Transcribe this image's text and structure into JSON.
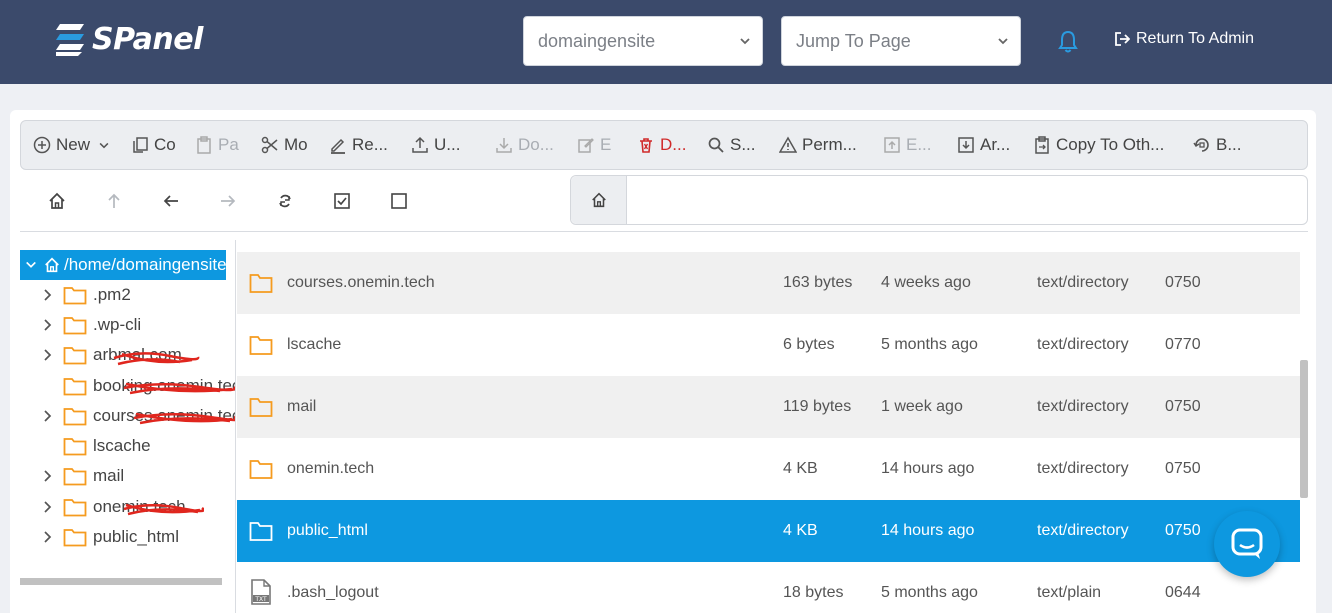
{
  "header": {
    "brand": "SPanel",
    "account_select": "domaingensite",
    "jump_to_page": "Jump To Page",
    "return_to_admin": "Return To Admin",
    "colors": {
      "header_bg": "#3b4a6b",
      "accent": "#0d98e0"
    }
  },
  "toolbar": {
    "new": "New",
    "copy": "Co",
    "paste": "Pa",
    "move": "Mo",
    "rename": "Re...",
    "upload": "U...",
    "download": "Do...",
    "edit": "E",
    "delete": "D...",
    "search": "S...",
    "permissions": "Perm...",
    "extract": "E...",
    "archive": "Ar...",
    "copy_to_other": "Copy To Oth...",
    "backup": "B..."
  },
  "tree": {
    "root": "/home/domaingensite",
    "items": [
      {
        "label": ".pm2",
        "expandable": true
      },
      {
        "label": ".wp-cli",
        "expandable": true
      },
      {
        "label": "arbmal.com",
        "expandable": true,
        "redacted": true
      },
      {
        "label": "booking.onemin.tech",
        "expandable": false,
        "redacted": true
      },
      {
        "label": "courses.onemin.tech",
        "expandable": true,
        "redacted": true
      },
      {
        "label": "lscache",
        "expandable": false
      },
      {
        "label": "mail",
        "expandable": true
      },
      {
        "label": "onemin.tech",
        "expandable": true,
        "redacted": true
      },
      {
        "label": "public_html",
        "expandable": true
      }
    ]
  },
  "files": [
    {
      "name": "courses.onemin.tech",
      "size": "163 bytes",
      "modified": "4 weeks ago",
      "type": "text/directory",
      "perms": "0750",
      "icon": "folder-icon"
    },
    {
      "name": "lscache",
      "size": "6 bytes",
      "modified": "5 months ago",
      "type": "text/directory",
      "perms": "0770",
      "icon": "folder-icon"
    },
    {
      "name": "mail",
      "size": "119 bytes",
      "modified": "1 week ago",
      "type": "text/directory",
      "perms": "0750",
      "icon": "folder-icon"
    },
    {
      "name": "onemin.tech",
      "size": "4 KB",
      "modified": "14 hours ago",
      "type": "text/directory",
      "perms": "0750",
      "icon": "folder-icon"
    },
    {
      "name": "public_html",
      "size": "4 KB",
      "modified": "14 hours ago",
      "type": "text/directory",
      "perms": "0750",
      "icon": "folder-icon",
      "selected": true
    },
    {
      "name": ".bash_logout",
      "size": "18 bytes",
      "modified": "5 months ago",
      "type": "text/plain",
      "perms": "0644",
      "icon": "text-file-icon"
    }
  ]
}
